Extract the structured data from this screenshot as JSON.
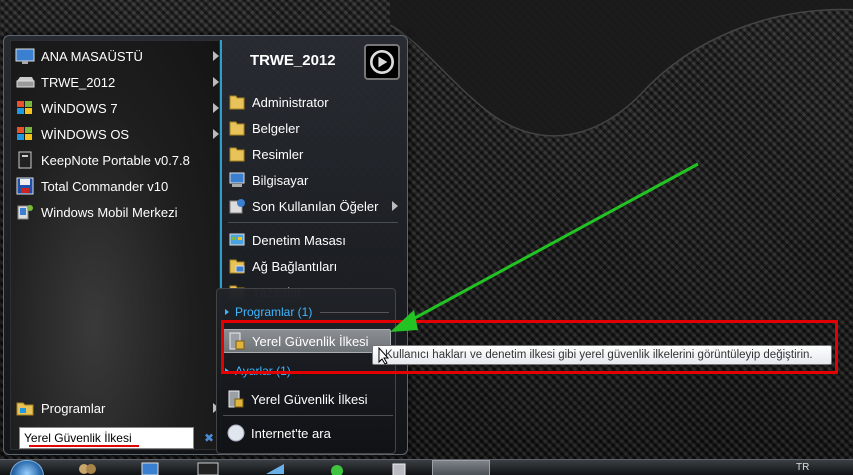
{
  "left_pane": {
    "pinned": [
      {
        "label": "ANA MASAÜSTÜ",
        "icon": "desktop-icon",
        "has_arrow": true
      },
      {
        "label": "TRWE_2012",
        "icon": "drive-icon",
        "has_arrow": true
      },
      {
        "label": "WİNDOWS 7",
        "icon": "windows-flag-icon",
        "has_arrow": true
      },
      {
        "label": "WİNDOWS OS",
        "icon": "windows-flag-icon",
        "has_arrow": true
      },
      {
        "label": "KeepNote Portable v0.7.8",
        "icon": "keepnote-icon",
        "has_arrow": false
      },
      {
        "label": "Total Commander v10",
        "icon": "floppy-icon",
        "has_arrow": false
      },
      {
        "label": "Windows Mobil Merkezi",
        "icon": "mobile-device-icon",
        "has_arrow": false
      }
    ],
    "all_programs_label": "Programlar",
    "search_value": "Yerel Güvenlik İlkesi",
    "clear_icon": "✖"
  },
  "right_pane": {
    "user_name": "TRWE_2012",
    "items": [
      {
        "label": "Administrator",
        "icon": "folder-icon",
        "has_arrow": false
      },
      {
        "label": "Belgeler",
        "icon": "folder-icon",
        "has_arrow": false
      },
      {
        "label": "Resimler",
        "icon": "folder-icon",
        "has_arrow": false
      },
      {
        "label": "Bilgisayar",
        "icon": "computer-icon",
        "has_arrow": false
      },
      {
        "label": "Son Kullanılan Öğeler",
        "icon": "recent-items-icon",
        "has_arrow": true
      },
      {
        "label": "Denetim Masası",
        "icon": "control-panel-icon",
        "has_arrow": false
      },
      {
        "label": "Ağ Bağlantıları",
        "icon": "network-icon",
        "has_arrow": false
      },
      {
        "label": "Yazıcılar",
        "icon": "printer-icon",
        "has_arrow": false
      }
    ]
  },
  "search_results": {
    "programs_header": "Programlar (1)",
    "programs_result": "Yerel Güvenlik İlkesi",
    "settings_header": "Ayarlar (1)",
    "settings_result": "Yerel Güvenlik İlkesi",
    "internet_search": "Internet'te ara"
  },
  "tooltip": {
    "text": "Kullanıcı hakları ve denetim ilkesi gibi yerel güvenlik ilkelerini görüntüleyip değiştirin."
  },
  "taskbar": {
    "language": "TR"
  },
  "colors": {
    "accent_blue": "#3fb8ff",
    "annotation_red": "#e30000",
    "annotation_green": "#22c322"
  }
}
